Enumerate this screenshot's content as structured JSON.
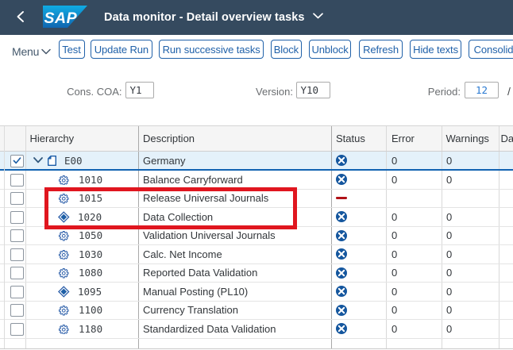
{
  "shell": {
    "title": "Data monitor - Detail overview tasks",
    "logo_text": "SAP",
    "bg_color": "#354a5f"
  },
  "toolbar": {
    "menu_label": "Menu",
    "buttons": [
      "Test",
      "Update Run",
      "Run successive tasks",
      "Block",
      "Unblock",
      "Refresh",
      "Hide texts",
      "Consolida"
    ]
  },
  "filters": {
    "items": [
      {
        "label": "Cons. COA:",
        "value": "Y1"
      },
      {
        "label": "Version:",
        "value": "Y10"
      },
      {
        "label": "Period:",
        "value": "12",
        "accent": "#2a7ad2"
      }
    ],
    "suffix": "/"
  },
  "table": {
    "columns": [
      "Hierarchy",
      "Description",
      "Status",
      "Error",
      "Warnings",
      "Da"
    ],
    "rows": [
      {
        "icon": "document-icon",
        "id": "E00",
        "description": "Germany",
        "status": "error-circle-icon",
        "error": "0",
        "warnings": "0",
        "checked": true,
        "selected": true,
        "expanded": true,
        "level": "root"
      },
      {
        "icon": "gear-icon",
        "id": "1010",
        "description": "Balance Carryforward",
        "status": "error-circle-icon",
        "error": "0",
        "warnings": "0"
      },
      {
        "icon": "gear-icon",
        "id": "1015",
        "description": "Release Universal Journals",
        "status": "red-dash-icon",
        "error": "",
        "warnings": ""
      },
      {
        "icon": "diamond-icon",
        "id": "1020",
        "description": "Data Collection",
        "status": "error-circle-icon",
        "error": "0",
        "warnings": "0"
      },
      {
        "icon": "gear-icon",
        "id": "1050",
        "description": "Validation Universal Journals",
        "status": "error-circle-icon",
        "error": "0",
        "warnings": "0"
      },
      {
        "icon": "gear-icon",
        "id": "1030",
        "description": "Calc. Net Income",
        "status": "error-circle-icon",
        "error": "0",
        "warnings": "0"
      },
      {
        "icon": "gear-icon",
        "id": "1080",
        "description": "Reported Data Validation",
        "status": "error-circle-icon",
        "error": "0",
        "warnings": "0"
      },
      {
        "icon": "diamond-icon",
        "id": "1095",
        "description": "Manual Posting (PL10)",
        "status": "error-circle-icon",
        "error": "0",
        "warnings": "0"
      },
      {
        "icon": "gear-icon",
        "id": "1100",
        "description": "Currency Translation",
        "status": "error-circle-icon",
        "error": "0",
        "warnings": "0"
      },
      {
        "icon": "gear-icon",
        "id": "1180",
        "description": "Standardized Data Validation",
        "status": "error-circle-icon",
        "error": "0",
        "warnings": "0"
      }
    ],
    "status_colors": {
      "error_circle": "#14569e",
      "red_dash": "#b01117",
      "selected_row_bg": "#e4f1fa",
      "selected_row_border": "#1263b2"
    }
  },
  "annotation": {
    "type": "red-box",
    "color": "#e0161f"
  }
}
